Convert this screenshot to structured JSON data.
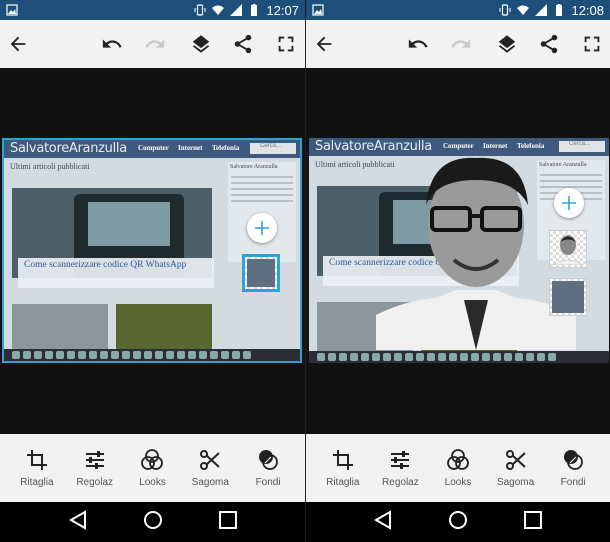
{
  "screens": [
    {
      "status": {
        "time": "12:07"
      },
      "toolbar": {
        "back_icon": "arrow-left-icon",
        "undo_icon": "undo-icon",
        "redo_icon": "redo-icon",
        "layers_icon": "layers-icon",
        "share_icon": "share-icon",
        "fullscreen_icon": "fullscreen-icon"
      },
      "photo": {
        "brand": "SalvatoreAranzulla",
        "nav": [
          "Computer",
          "Internet",
          "Telefonia"
        ],
        "search_placeholder": "Cerca...",
        "subtitle": "Ultimi articoli pubblicati",
        "caption": "Come scannerizzare codice QR WhatsApp",
        "side_title": "Salvatore Aranzulla"
      },
      "layers": [
        "photo-layer"
      ]
    },
    {
      "status": {
        "time": "12:08"
      },
      "toolbar": {
        "back_icon": "arrow-left-icon",
        "undo_icon": "undo-icon",
        "redo_icon": "redo-icon",
        "layers_icon": "layers-icon",
        "share_icon": "share-icon",
        "fullscreen_icon": "fullscreen-icon"
      },
      "photo": {
        "brand": "SalvatoreAranzulla",
        "nav": [
          "Computer",
          "Internet",
          "Telefonia"
        ],
        "search_placeholder": "Cerca...",
        "subtitle": "Ultimi articoli pubblicati",
        "caption": "Come scannerizzare codice QR WhatsApp",
        "side_title": "Salvatore Aranzulla"
      },
      "layers": [
        "person-layer",
        "photo-layer"
      ]
    }
  ],
  "tools": [
    {
      "label": "Ritaglia",
      "icon": "crop-icon"
    },
    {
      "label": "Regolaz",
      "icon": "adjust-sliders-icon"
    },
    {
      "label": "Looks",
      "icon": "looks-circles-icon"
    },
    {
      "label": "Sagoma",
      "icon": "scissors-icon"
    },
    {
      "label": "Fondi",
      "icon": "blend-icon"
    }
  ],
  "nav": {
    "back": "back-triangle-icon",
    "home": "home-circle-icon",
    "recents": "recents-square-icon"
  },
  "colors": {
    "statusbar": "#1e4f7a",
    "toolbar": "#f2f2f2",
    "selection": "#2ea3d8",
    "canvas": "#111111"
  }
}
